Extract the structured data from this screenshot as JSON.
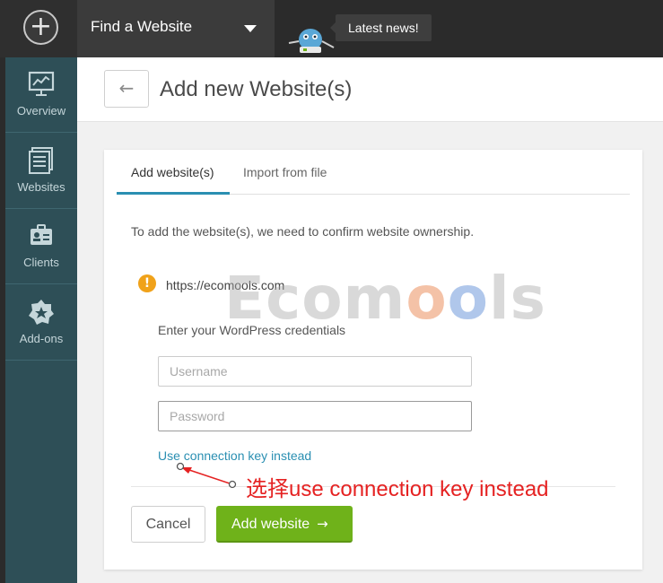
{
  "topbar": {
    "add_icon": "plus-icon",
    "site_selector_label": "Find a Website",
    "news_label": "Latest news!"
  },
  "sidebar": {
    "items": [
      {
        "label": "Overview",
        "icon": "overview-chart-icon"
      },
      {
        "label": "Websites",
        "icon": "websites-list-icon"
      },
      {
        "label": "Clients",
        "icon": "clients-badge-icon"
      },
      {
        "label": "Add-ons",
        "icon": "addons-star-icon"
      }
    ]
  },
  "header": {
    "back_icon": "←",
    "title": "Add new Website(s)"
  },
  "tabs": [
    {
      "label": "Add website(s)",
      "active": true
    },
    {
      "label": "Import from file",
      "active": false
    }
  ],
  "form": {
    "intro": "To add the website(s), we need to confirm website ownership.",
    "warning_icon": "!",
    "site_url": "https://ecomools.com",
    "credentials_title": "Enter your WordPress credentials",
    "username_placeholder": "Username",
    "password_placeholder": "Password",
    "connection_key_link": "Use connection key instead",
    "cancel_label": "Cancel",
    "submit_label": "Add website",
    "submit_arrow": "→"
  },
  "watermark": {
    "text_pre": "Ecom",
    "o1": "o",
    "o2": "o",
    "text_post": "ls"
  },
  "annotation": {
    "text": "选择use connection key instead"
  },
  "colors": {
    "sidebar_bg": "#2e4f57",
    "accent_blue": "#2a8fb2",
    "submit_green": "#6fb21a",
    "warning_orange": "#f0a21a",
    "annotation_red": "#e52222"
  }
}
